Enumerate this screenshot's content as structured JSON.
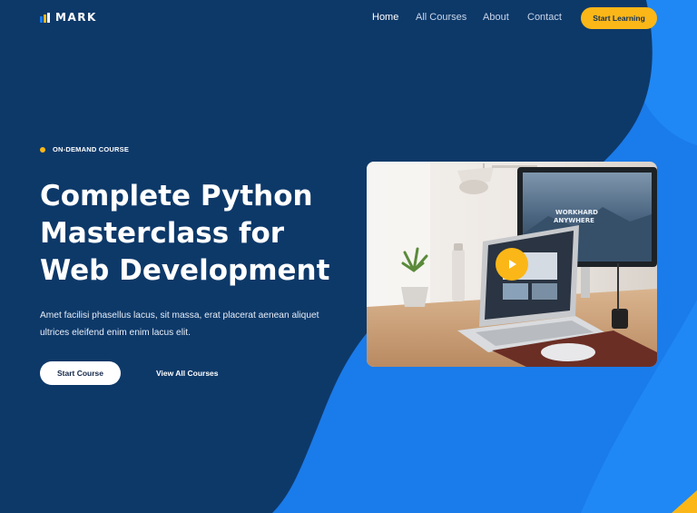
{
  "brand": {
    "name": "MARK",
    "logo_icon": "bar-chart-logo-icon"
  },
  "nav": {
    "links": [
      {
        "label": "Home",
        "active": true
      },
      {
        "label": "All Courses",
        "active": false
      },
      {
        "label": "About",
        "active": false
      },
      {
        "label": "Contact",
        "active": false
      }
    ],
    "cta_label": "Start Learning"
  },
  "hero": {
    "eyebrow": "ON-DEMAND COURSE",
    "title_lines": [
      "Complete Python",
      "Masterclass for",
      "Web Development"
    ],
    "description": "Amet facilisi phasellus lacus, sit massa, erat placerat aenean aliquet ultrices eleifend enim enim lacus elit.",
    "primary_button": "Start Course",
    "secondary_link": "View All Courses"
  },
  "media": {
    "type": "video-thumbnail",
    "play_icon": "play-icon",
    "monitor_text_line1": "WORKHARD",
    "monitor_text_line2": "ANYWHERE"
  },
  "colors": {
    "navy": "#0d3969",
    "blue": "#1a7bea",
    "accent": "#fbb717",
    "white": "#ffffff"
  }
}
